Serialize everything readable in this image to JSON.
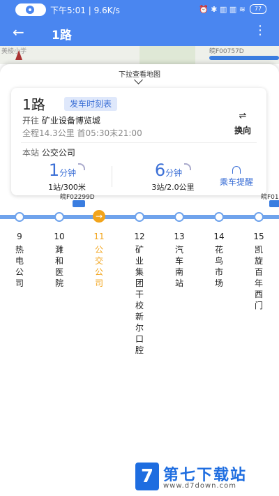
{
  "status_bar": {
    "time_speed": "下午5:01 | 9.6K/s",
    "right_icons": "⏰ ✱ ▥ ▥ ≋",
    "battery": "77"
  },
  "app_bar": {
    "back_icon": "←",
    "title": "1路",
    "more_icon": "⋮"
  },
  "map": {
    "left_label": "美棱小学",
    "right_label": "皖F00757D"
  },
  "sheet": {
    "pull_hint": "下拉查看地图"
  },
  "line_card": {
    "line_name": "1路",
    "schedule_label": "发车时刻表",
    "direction_prefix": "开往",
    "direction_dest": "矿业设备博览城",
    "meta": "全程14.3公里  首05:30末21:00",
    "swap_icon": "⇌",
    "swap_label": "换向",
    "stop_prefix": "本站",
    "stop_name": "公交公司",
    "eta": [
      {
        "minutes": "1",
        "unit": "分钟",
        "detail": "1站/300米"
      },
      {
        "minutes": "6",
        "unit": "分钟",
        "detail": "3站/2.0公里"
      }
    ],
    "remind_label": "乘车提醒"
  },
  "route": {
    "buses": [
      {
        "plate": "皖F02299D"
      },
      {
        "plate": "皖F01"
      }
    ],
    "current_icon": "→",
    "stops": [
      {
        "num": "9",
        "name": [
          "热",
          "电",
          "公",
          "司"
        ]
      },
      {
        "num": "10",
        "name": [
          "濉",
          "和",
          "医",
          "院"
        ]
      },
      {
        "num": "11",
        "name": [
          "公",
          "交",
          "公",
          "司"
        ]
      },
      {
        "num": "12",
        "name": [
          "矿",
          "业",
          "集",
          "团",
          "干",
          "校",
          "新",
          "尔",
          "口",
          "腔"
        ]
      },
      {
        "num": "13",
        "name": [
          "汽",
          "车",
          "南",
          "站"
        ]
      },
      {
        "num": "14",
        "name": [
          "花",
          "鸟",
          "市",
          "场"
        ]
      },
      {
        "num": "15",
        "name": [
          "凯",
          "旋",
          "百",
          "年",
          "西",
          "门"
        ]
      }
    ]
  },
  "watermark": {
    "logo_char": "7",
    "title": "第七下载站",
    "url": "www.d7down.com"
  }
}
